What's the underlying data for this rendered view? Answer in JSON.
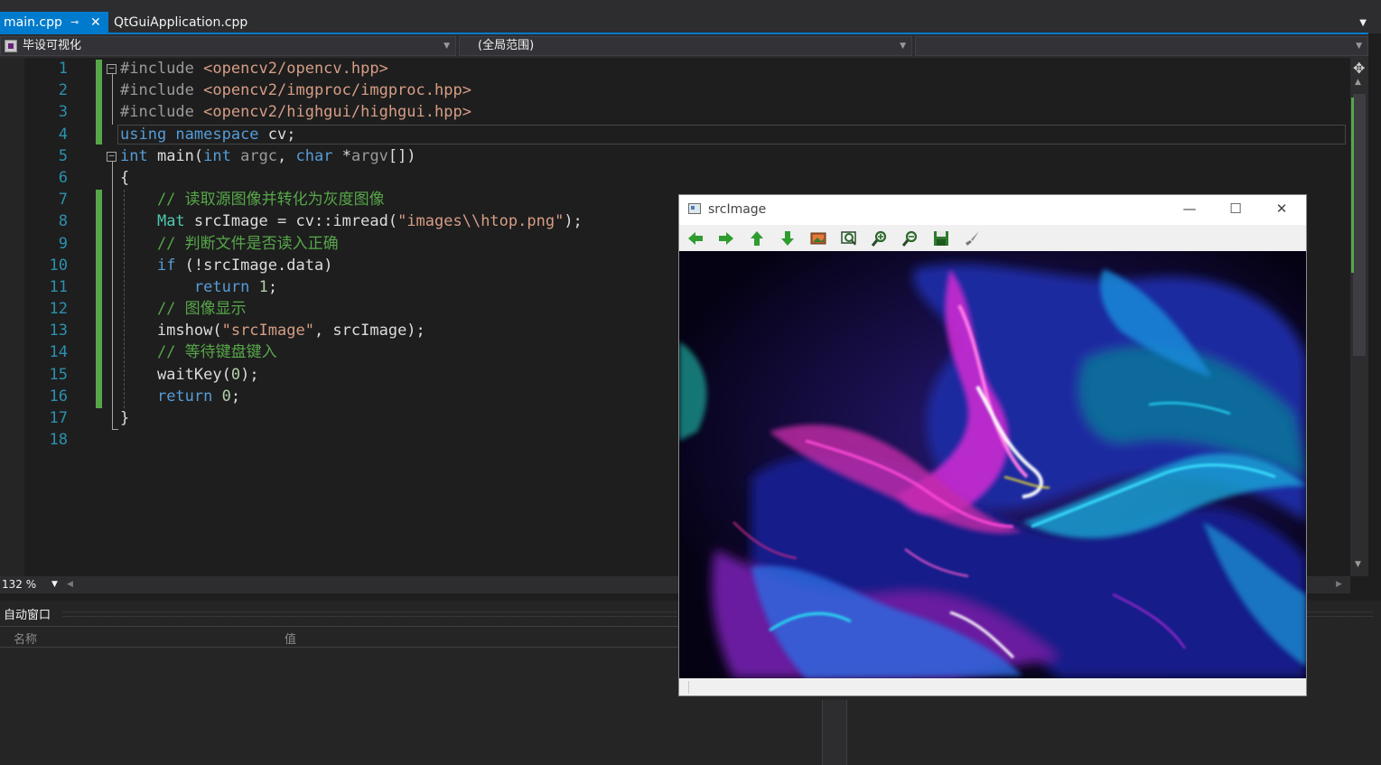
{
  "tabs": [
    {
      "label": "main.cpp",
      "active": true,
      "pin_icon": "pin-icon",
      "close_icon": "close-icon"
    },
    {
      "label": "QtGuiApplication.cpp",
      "active": false
    }
  ],
  "navbar": {
    "project": "毕设可视化",
    "scope": "(全局范围)",
    "member": ""
  },
  "editor": {
    "line_numbers": [
      "1",
      "2",
      "3",
      "4",
      "5",
      "6",
      "7",
      "8",
      "9",
      "10",
      "11",
      "12",
      "13",
      "14",
      "15",
      "16",
      "17",
      "18"
    ],
    "zoom": "132 %"
  },
  "code_lines": [
    {
      "segments": [
        {
          "t": "#include ",
          "c": "pp"
        },
        {
          "t": "<opencv2/opencv.hpp>",
          "c": "inc"
        }
      ]
    },
    {
      "segments": [
        {
          "t": "#include ",
          "c": "pp"
        },
        {
          "t": "<opencv2/imgproc/imgproc.hpp>",
          "c": "inc"
        }
      ]
    },
    {
      "segments": [
        {
          "t": "#include ",
          "c": "pp"
        },
        {
          "t": "<opencv2/highgui/highgui.hpp>",
          "c": "inc"
        }
      ]
    },
    {
      "segments": [
        {
          "t": "using ",
          "c": "kw"
        },
        {
          "t": "namespace ",
          "c": "kw"
        },
        {
          "t": "cv;",
          "c": ""
        }
      ]
    },
    {
      "segments": [
        {
          "t": "int ",
          "c": "kw"
        },
        {
          "t": "main(",
          "c": ""
        },
        {
          "t": "int ",
          "c": "kw"
        },
        {
          "t": "argc",
          "c": "prm"
        },
        {
          "t": ", ",
          "c": ""
        },
        {
          "t": "char ",
          "c": "kw"
        },
        {
          "t": "*",
          "c": ""
        },
        {
          "t": "argv",
          "c": "prm"
        },
        {
          "t": "[])",
          "c": ""
        }
      ]
    },
    {
      "segments": [
        {
          "t": "{",
          "c": ""
        }
      ]
    },
    {
      "segments": [
        {
          "t": "    // 读取源图像并转化为灰度图像",
          "c": "cm"
        }
      ]
    },
    {
      "segments": [
        {
          "t": "    ",
          "c": ""
        },
        {
          "t": "Mat",
          "c": "ty"
        },
        {
          "t": " srcImage = cv::imread(",
          "c": ""
        },
        {
          "t": "\"images\\\\htop.png\"",
          "c": "str"
        },
        {
          "t": ");",
          "c": ""
        }
      ]
    },
    {
      "segments": [
        {
          "t": "    // 判断文件是否读入正确",
          "c": "cm"
        }
      ]
    },
    {
      "segments": [
        {
          "t": "    ",
          "c": ""
        },
        {
          "t": "if",
          "c": "kw"
        },
        {
          "t": " (!srcImage.data)",
          "c": ""
        }
      ]
    },
    {
      "segments": [
        {
          "t": "        ",
          "c": ""
        },
        {
          "t": "return",
          "c": "kw"
        },
        {
          "t": " ",
          "c": ""
        },
        {
          "t": "1",
          "c": "num"
        },
        {
          "t": ";",
          "c": ""
        }
      ]
    },
    {
      "segments": [
        {
          "t": "    // 图像显示",
          "c": "cm"
        }
      ]
    },
    {
      "segments": [
        {
          "t": "    imshow(",
          "c": ""
        },
        {
          "t": "\"srcImage\"",
          "c": "str"
        },
        {
          "t": ", srcImage);",
          "c": ""
        }
      ]
    },
    {
      "segments": [
        {
          "t": "    // 等待键盘键入",
          "c": "cm"
        }
      ]
    },
    {
      "segments": [
        {
          "t": "    waitKey(",
          "c": ""
        },
        {
          "t": "0",
          "c": "num"
        },
        {
          "t": ");",
          "c": ""
        }
      ]
    },
    {
      "segments": [
        {
          "t": "    ",
          "c": ""
        },
        {
          "t": "return",
          "c": "kw"
        },
        {
          "t": " ",
          "c": ""
        },
        {
          "t": "0",
          "c": "num"
        },
        {
          "t": ";",
          "c": ""
        }
      ]
    },
    {
      "segments": [
        {
          "t": "}",
          "c": ""
        }
      ]
    },
    {
      "segments": []
    }
  ],
  "autos": {
    "title": "自动窗口",
    "col_name": "名称",
    "col_value": "值"
  },
  "image_window": {
    "title": "srcImage",
    "minimize": "—",
    "maximize": "☐",
    "close": "✕",
    "toolbar": [
      "arrow-left-icon",
      "arrow-right-icon",
      "arrow-up-icon",
      "arrow-down-icon",
      "picture-icon",
      "zoom-fit-icon",
      "zoom-in-icon",
      "zoom-out-icon",
      "save-icon",
      "brush-icon"
    ]
  },
  "colors": {
    "accent": "#007acc",
    "editor_bg": "#1e1e1e",
    "keyword": "#569cd6",
    "comment": "#57a64a",
    "string": "#d69d85",
    "line_number": "#2b91af",
    "toolbar_green": "#2e9c2e"
  }
}
